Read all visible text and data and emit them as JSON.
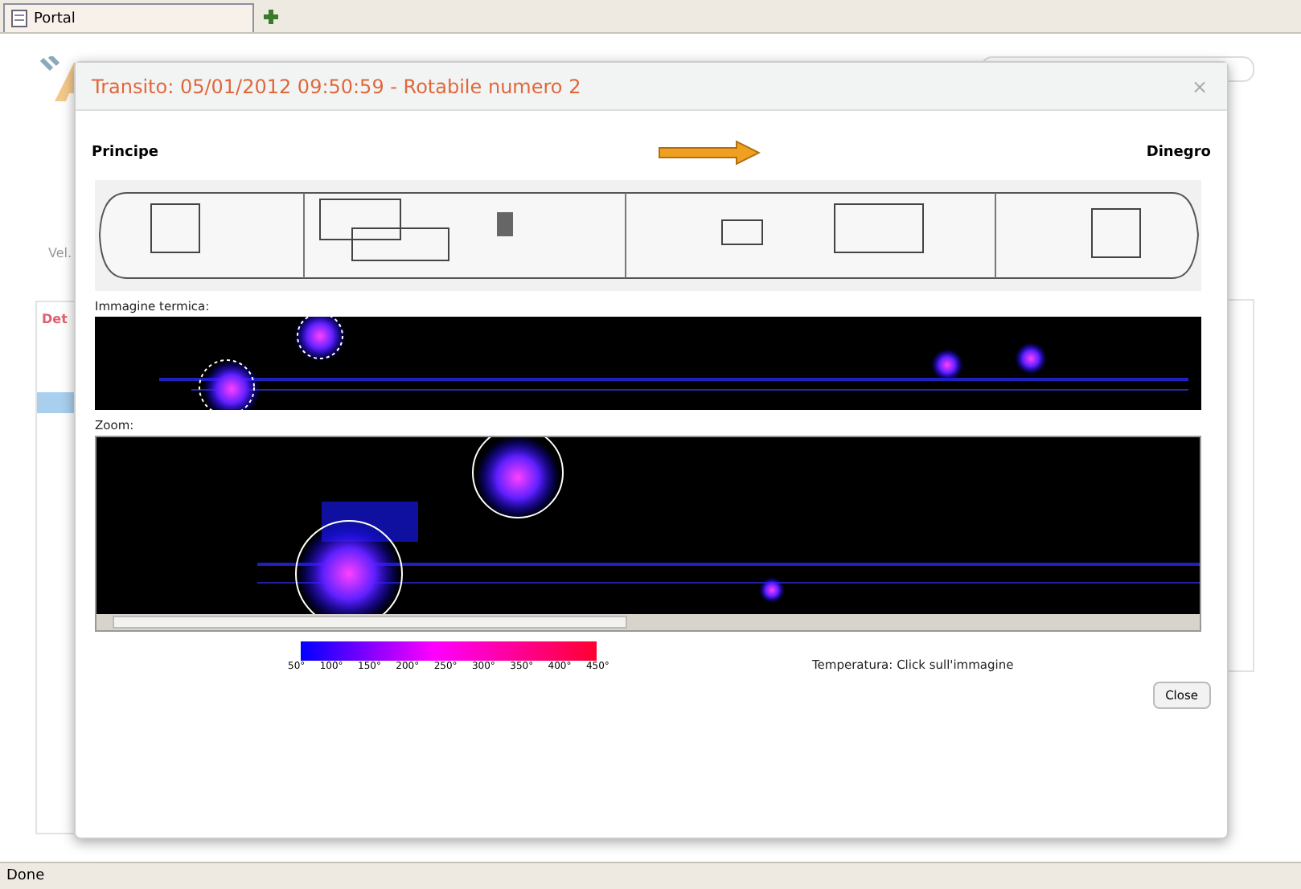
{
  "browser": {
    "tabs": [
      {
        "label": "Portal",
        "selected": true
      }
    ],
    "status": "Done"
  },
  "background": {
    "label": "Vel.",
    "panel_title": "Det"
  },
  "dialog": {
    "title": "Transito: 05/01/2012 09:50:59 - Rotabile numero 2",
    "close": "×",
    "from": "Principe",
    "to": "Dinegro",
    "thermal_label": "Immagine termica:",
    "zoom_label": "Zoom:",
    "scale_ticks": [
      "50°",
      "100°",
      "150°",
      "200°",
      "250°",
      "300°",
      "350°",
      "400°",
      "450°"
    ],
    "temperature": "Temperatura: Click sull'immagine",
    "button": "Close"
  }
}
